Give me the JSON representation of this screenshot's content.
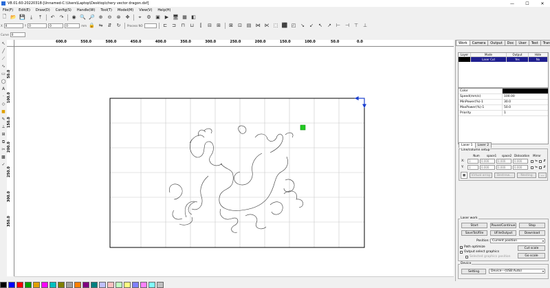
{
  "window": {
    "title": "V8.01.60-20220318-[Unnamed-C:\\Users\\Laptop\\Desktop\\chery vector dragon.dxf]",
    "minimize": "—",
    "maximize": "☐",
    "close": "✕"
  },
  "menu": [
    {
      "label": "File(F)"
    },
    {
      "label": "Edit(E)"
    },
    {
      "label": "Draw(D)"
    },
    {
      "label": "Config(S)"
    },
    {
      "label": "Handle(W)"
    },
    {
      "label": "Tool(T)"
    },
    {
      "label": "Model(M)"
    },
    {
      "label": "View(V)"
    },
    {
      "label": "Help(H)"
    }
  ],
  "toolbar2": {
    "x_label": "X",
    "y_label": "Y",
    "x_value": "0",
    "y_value": "0",
    "w_value": "0",
    "h_value": "0",
    "unit": "mm",
    "process_label": "Process NO"
  },
  "toolbar3": {
    "cursor_label": "Curve",
    "cursor_value": "0"
  },
  "ruler": {
    "h_ticks": [
      "600.0",
      "550.0",
      "500.0",
      "450.0",
      "400.0",
      "350.0",
      "300.0",
      "250.0",
      "200.0",
      "150.0",
      "100.0",
      "50.0",
      "0.0"
    ],
    "v_ticks": [
      "50.0",
      "100.0",
      "150.0",
      "200.0",
      "250.0",
      "300.0",
      "350.0"
    ]
  },
  "panel": {
    "tabs": [
      {
        "label": "Work",
        "active": true
      },
      {
        "label": "Camera"
      },
      {
        "label": "Output"
      },
      {
        "label": "Doc"
      },
      {
        "label": "User"
      },
      {
        "label": "Test"
      },
      {
        "label": "Transform"
      }
    ],
    "layer_headers": [
      "Layer",
      "Mode",
      "Output",
      "Hide"
    ],
    "layers": [
      {
        "layer": "",
        "mode": "Laser Cut",
        "output": "Yes",
        "hide": "No"
      }
    ],
    "props": [
      {
        "k": "Color",
        "v": ""
      },
      {
        "k": "Speed(mm/s)",
        "v": "100.00"
      },
      {
        "k": "MinPower(%)-1",
        "v": "30.0"
      },
      {
        "k": "MaxPower(%)-1",
        "v": "50.0"
      },
      {
        "k": "Priority",
        "v": "1"
      }
    ],
    "layer_tabs": [
      {
        "label": "Laser 1"
      },
      {
        "label": "Laser 2"
      }
    ],
    "array": {
      "group": "Line/column setup",
      "headers": [
        "Num",
        "space1",
        "space2",
        "Dislocation",
        "Mirror"
      ],
      "x_label": "X:",
      "y_label": "Y:",
      "x_num": "1",
      "x_s1": "0.000",
      "x_s2": "0.000",
      "x_dis": "0.000",
      "y_num": "1",
      "y_s1": "0.000",
      "y_s2": "0.000",
      "y_dis": "0.000",
      "virtual": "Virtual array",
      "bestrew": "Bestrew...",
      "nesting": "Nesting",
      "more": "..."
    },
    "laserwork": {
      "group": "Laser work",
      "start": "Start",
      "pause": "Pause/Continue",
      "stop": "Stop",
      "save": "SaveToUFile",
      "ufile": "UFileOutput",
      "download": "Download",
      "position_label": "Position:",
      "position_value": "Current position",
      "path_opt": "Path optimize",
      "output_sel": "Output select graphics",
      "sel_graphics": "Selected graphics position",
      "cut_scale": "Cut scale",
      "go_scale": "Go scale"
    },
    "device": {
      "group": "Device",
      "setting": "Setting",
      "value": "Device---(USB:Auto)"
    }
  },
  "colors": {
    "accent": "#1f1f8f",
    "swatches": [
      "#000000",
      "#0000ff",
      "#ff0000",
      "#00a000",
      "#e0a000",
      "#ff00ff",
      "#00c0c0",
      "#808000",
      "#a0a0a0",
      "#ff8000",
      "#800080",
      "#008080",
      "#c0c0ff",
      "#ffc0c0",
      "#c0ffc0",
      "#ffff80",
      "#8080ff",
      "#ff80ff",
      "#80ffff",
      "#c0c0c0"
    ]
  }
}
